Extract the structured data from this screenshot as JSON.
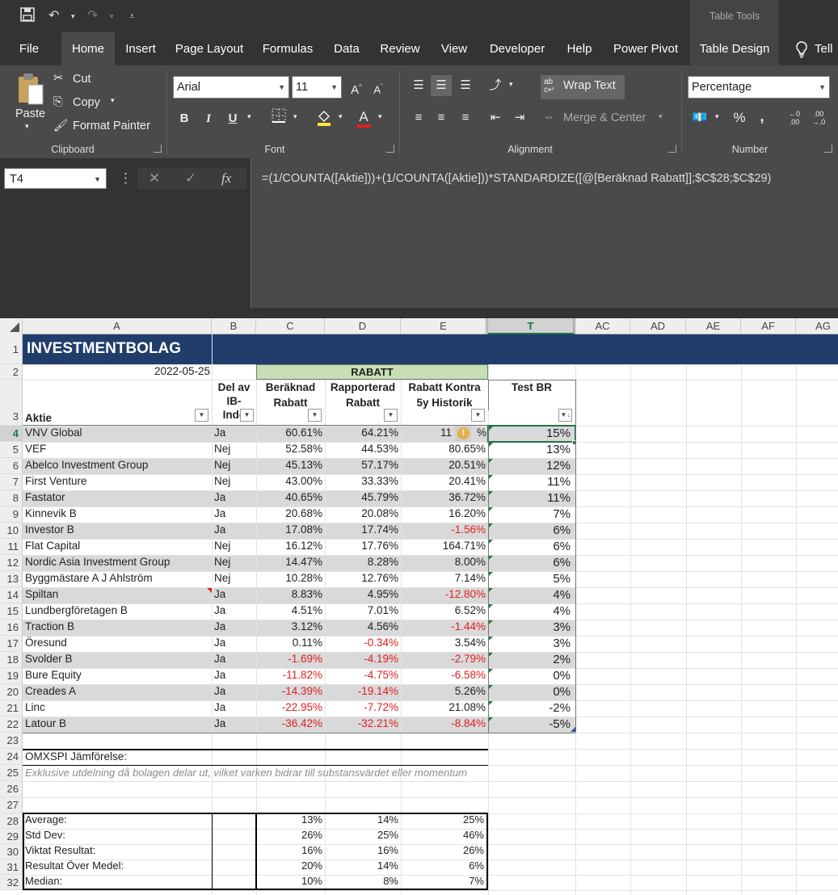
{
  "titlebar": {
    "context_tab": "Table Tools"
  },
  "tabs": [
    "File",
    "Home",
    "Insert",
    "Page Layout",
    "Formulas",
    "Data",
    "Review",
    "View",
    "Developer",
    "Help",
    "Power Pivot",
    "Table Design",
    "Tell"
  ],
  "ribbon": {
    "clipboard": {
      "paste": "Paste",
      "cut": "Cut",
      "copy": "Copy",
      "format_painter": "Format Painter",
      "group": "Clipboard"
    },
    "font": {
      "name": "Arial",
      "size": "11",
      "bold": "B",
      "italic": "I",
      "underline": "U",
      "group": "Font"
    },
    "alignment": {
      "wrap_text": "Wrap Text",
      "merge_center": "Merge & Center",
      "group": "Alignment"
    },
    "number": {
      "format": "Percentage",
      "percent": "%",
      "comma": ",",
      "group": "Number"
    }
  },
  "formula_bar": {
    "name_box": "T4",
    "fx": "fx",
    "formula": "=(1/COUNTA([Aktie]))+(1/COUNTA([Aktie]))*STANDARDIZE([@[Beräknad Rabatt]];$C$28;$C$29)"
  },
  "columns": [
    "A",
    "B",
    "C",
    "D",
    "E",
    "T",
    "AC",
    "AD",
    "AE",
    "AF",
    "AG"
  ],
  "sheet": {
    "title": "INVESTMENTBOLAG",
    "date": "2022-05-25",
    "rabatt_header": "RABATT",
    "headers": {
      "aktie": "Aktie",
      "del_av_ib": [
        "Del av",
        "IB-",
        "Inde"
      ],
      "beraknad": [
        "Beräknad",
        "Rabatt"
      ],
      "rapporterad": [
        "Rapporterad",
        "Rabatt"
      ],
      "kontra": [
        "Rabatt Kontra",
        "5y Historik"
      ],
      "test_br": "Test BR"
    },
    "rows": [
      {
        "aktie": "VNV Global",
        "ib": "Ja",
        "c": "60.61%",
        "d": "64.21%",
        "e": "11",
        "e2": "%",
        "t": "15%"
      },
      {
        "aktie": "VEF",
        "ib": "Nej",
        "c": "52.58%",
        "d": "44.53%",
        "e": "80.65%",
        "t": "13%"
      },
      {
        "aktie": "Abelco Investment Group",
        "ib": "Nej",
        "c": "45.13%",
        "d": "57.17%",
        "e": "20.51%",
        "t": "12%"
      },
      {
        "aktie": "First Venture",
        "ib": "Nej",
        "c": "43.00%",
        "d": "33.33%",
        "e": "20.41%",
        "t": "11%"
      },
      {
        "aktie": "Fastator",
        "ib": "Ja",
        "c": "40.65%",
        "d": "45.79%",
        "e": "36.72%",
        "t": "11%"
      },
      {
        "aktie": "Kinnevik B",
        "ib": "Ja",
        "c": "20.68%",
        "d": "20.08%",
        "e": "16.20%",
        "t": "7%"
      },
      {
        "aktie": "Investor B",
        "ib": "Ja",
        "c": "17.08%",
        "d": "17.74%",
        "e": "-1.56%",
        "t": "6%"
      },
      {
        "aktie": "Flat Capital",
        "ib": "Nej",
        "c": "16.12%",
        "d": "17.76%",
        "e": "164.71%",
        "t": "6%"
      },
      {
        "aktie": "Nordic Asia Investment Group",
        "ib": "Nej",
        "c": "14.47%",
        "d": "8.28%",
        "e": "8.00%",
        "t": "6%"
      },
      {
        "aktie": "Byggmästare A J Ahlström",
        "ib": "Nej",
        "c": "10.28%",
        "d": "12.76%",
        "e": "7.14%",
        "t": "5%"
      },
      {
        "aktie": "Spiltan",
        "ib": "Ja",
        "c": "8.83%",
        "d": "4.95%",
        "e": "-12.80%",
        "t": "4%"
      },
      {
        "aktie": "Lundbergföretagen B",
        "ib": "Ja",
        "c": "4.51%",
        "d": "7.01%",
        "e": "6.52%",
        "t": "4%"
      },
      {
        "aktie": "Traction B",
        "ib": "Ja",
        "c": "3.12%",
        "d": "4.56%",
        "e": "-1.44%",
        "t": "3%"
      },
      {
        "aktie": "Öresund",
        "ib": "Ja",
        "c": "0.11%",
        "d": "-0.34%",
        "e": "3.54%",
        "t": "3%"
      },
      {
        "aktie": "Svolder B",
        "ib": "Ja",
        "c": "-1.69%",
        "d": "-4.19%",
        "e": "-2.79%",
        "t": "2%"
      },
      {
        "aktie": "Bure Equity",
        "ib": "Ja",
        "c": "-11.82%",
        "d": "-4.75%",
        "e": "-6.58%",
        "t": "0%"
      },
      {
        "aktie": "Creades A",
        "ib": "Ja",
        "c": "-14.39%",
        "d": "-19.14%",
        "e": "5.26%",
        "t": "0%"
      },
      {
        "aktie": "Linc",
        "ib": "Ja",
        "c": "-22.95%",
        "d": "-7.72%",
        "e": "21.08%",
        "t": "-2%"
      },
      {
        "aktie": "Latour B",
        "ib": "Ja",
        "c": "-36.42%",
        "d": "-32.21%",
        "e": "-8.84%",
        "t": "-5%"
      }
    ],
    "omx_label": "OMXSPI Jämförelse:",
    "note": "Exklusive utdelning då bolagen delar ut, vilket varken bidrar till substansvärdet eller momentum",
    "stats": [
      {
        "label": "Average:",
        "c": "13%",
        "d": "14%",
        "e": "25%"
      },
      {
        "label": "Std Dev:",
        "c": "26%",
        "d": "25%",
        "e": "46%"
      },
      {
        "label": "Viktat Resultat:",
        "c": "16%",
        "d": "16%",
        "e": "26%"
      },
      {
        "label": "Resultat Över Medel:",
        "c": "20%",
        "d": "14%",
        "e": "6%"
      },
      {
        "label": "Median:",
        "c": "10%",
        "d": "8%",
        "e": "7%"
      }
    ]
  }
}
